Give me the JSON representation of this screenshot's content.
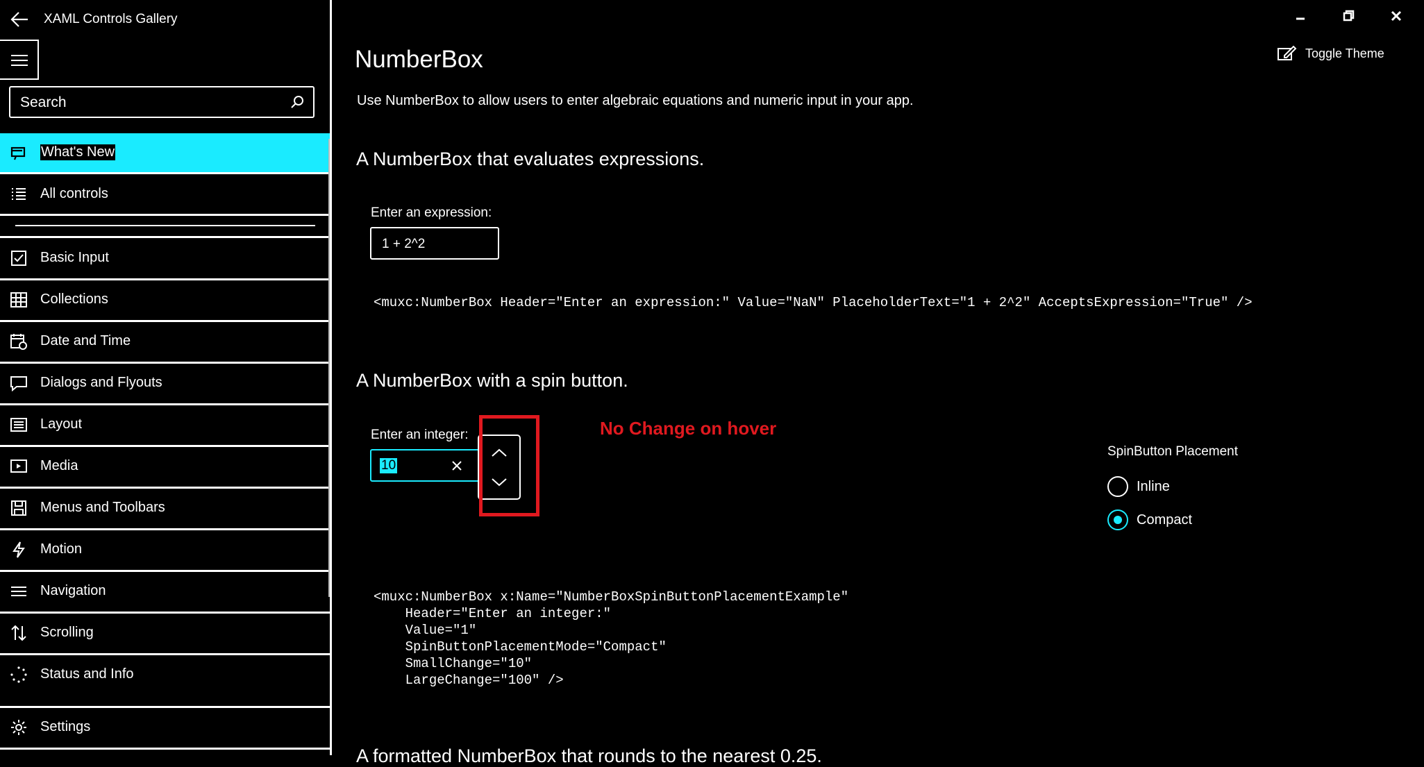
{
  "app": {
    "title": "XAML Controls Gallery"
  },
  "search": {
    "placeholder": "Search"
  },
  "nav": {
    "items": [
      {
        "label": "What's New",
        "icon": "megaphone-icon"
      },
      {
        "label": "All controls",
        "icon": "list-icon"
      },
      {
        "label": "Basic Input",
        "icon": "checkbox-icon"
      },
      {
        "label": "Collections",
        "icon": "grid-icon"
      },
      {
        "label": "Date and Time",
        "icon": "calendar-clock-icon"
      },
      {
        "label": "Dialogs and Flyouts",
        "icon": "speech-bubble-icon"
      },
      {
        "label": "Layout",
        "icon": "layout-icon"
      },
      {
        "label": "Media",
        "icon": "media-icon"
      },
      {
        "label": "Menus and Toolbars",
        "icon": "save-icon"
      },
      {
        "label": "Motion",
        "icon": "lightning-icon"
      },
      {
        "label": "Navigation",
        "icon": "navigation-icon"
      },
      {
        "label": "Scrolling",
        "icon": "scroll-arrows-icon"
      },
      {
        "label": "Status and Info",
        "icon": "progress-ring-icon"
      },
      {
        "label": "Settings",
        "icon": "gear-icon"
      }
    ]
  },
  "header": {
    "toggle_theme": "Toggle Theme"
  },
  "page": {
    "title": "NumberBox",
    "description": "Use NumberBox to allow users to enter algebraic equations and numeric input in your app.",
    "section1": {
      "heading": "A NumberBox that evaluates expressions.",
      "label": "Enter an expression:",
      "placeholder": "1 + 2^2",
      "code": "<muxc:NumberBox Header=\"Enter an expression:\" Value=\"NaN\" PlaceholderText=\"1 + 2^2\" AcceptsExpression=\"True\" />"
    },
    "section2": {
      "heading": "A NumberBox with a spin button.",
      "label": "Enter an integer:",
      "value": "10",
      "annotation": "No Change on hover",
      "placement_header": "SpinButton Placement",
      "options": [
        {
          "label": "Inline",
          "checked": false
        },
        {
          "label": "Compact",
          "checked": true
        }
      ],
      "code": "<muxc:NumberBox x:Name=\"NumberBoxSpinButtonPlacementExample\"\n    Header=\"Enter an integer:\"\n    Value=\"1\"\n    SpinButtonPlacementMode=\"Compact\"\n    SmallChange=\"10\"\n    LargeChange=\"100\" />"
    },
    "section3": {
      "heading_partial": "A formatted NumberBox that rounds to the nearest 0.25."
    }
  },
  "colors": {
    "accent": "#1AEBFF",
    "annotation_red": "#E0191F",
    "background": "#000000",
    "foreground": "#FFFFFF"
  }
}
